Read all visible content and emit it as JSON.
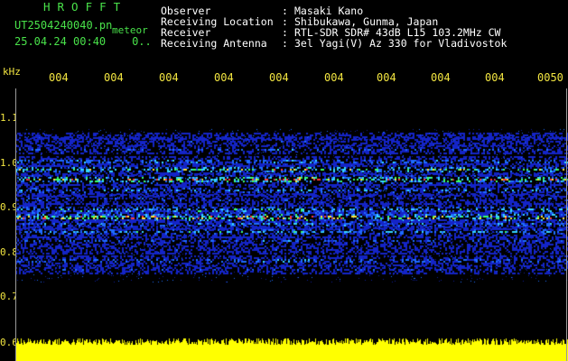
{
  "header": {
    "brand": "HROFFT",
    "filename": "UT2504240040.pn",
    "meteor_label": "meteor",
    "datetime": "25.04.24 00:40",
    "datetime_extra": "0..",
    "info": [
      {
        "label": "Observer",
        "value": "Masaki Kano"
      },
      {
        "label": "Receiving Location",
        "value": "Shibukawa, Gunma, Japan"
      },
      {
        "label": "Receiver",
        "value": "RTL-SDR SDR# 43dB L15 103.2MHz CW"
      },
      {
        "label": "Receiving Antenna",
        "value": "3el Yagi(V) Az 330 for Vladivostok"
      }
    ],
    "separator": ":"
  },
  "spectrogram": {
    "unit": "kHz",
    "y_ticks": [
      "1.1",
      "1.0",
      "0.9",
      "0.8",
      "0.7",
      "0.6"
    ],
    "x_ticks": [
      "004",
      "004",
      "004",
      "004",
      "004",
      "004",
      "004",
      "004",
      "004",
      "0050"
    ],
    "colors": {
      "text_label": "#ffffff",
      "brand": "#49e24a",
      "ticks": "#f3e641",
      "noise": "#ffff00"
    }
  }
}
